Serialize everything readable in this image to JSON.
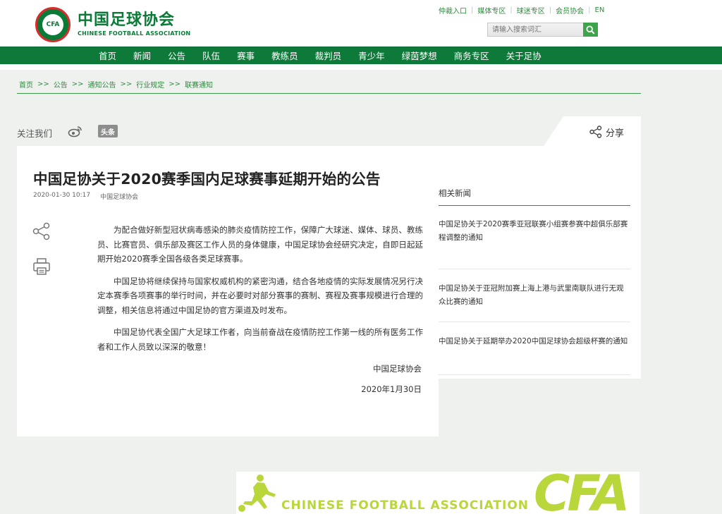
{
  "header": {
    "logo_cn": "中国足球协会",
    "logo_en": "CHINESE FOOTBALL ASSOCIATION",
    "logo_emblem_text": "CFA",
    "top_links": [
      "仲裁入口",
      "媒体专区",
      "球迷专区",
      "会员协会",
      "EN"
    ],
    "search_placeholder": "请输入搜索词汇"
  },
  "nav": {
    "items": [
      "首页",
      "新闻",
      "公告",
      "队伍",
      "赛事",
      "教练员",
      "裁判员",
      "青少年",
      "绿茵梦想",
      "商务专区",
      "关于足协"
    ]
  },
  "breadcrumb": {
    "items": [
      "首页",
      "公告",
      "通知公告",
      "行业规定",
      "联赛通知"
    ],
    "separator": ">>"
  },
  "follow": {
    "label": "关注我们",
    "toutiao": "头条",
    "share_label": "分享"
  },
  "article": {
    "title": "中国足协关于2020赛季国内足球赛事延期开始的公告",
    "date": "2020-01-30 10:17",
    "source": "中国足球协会",
    "paragraphs": [
      "为配合做好新型冠状病毒感染的肺炎疫情防控工作，保障广大球迷、媒体、球员、教练员、比赛官员、俱乐部及赛区工作人员的身体健康，中国足球协会经研究决定，自即日起延期开始2020赛季全国各级各类足球赛事。",
      "中国足协将继续保持与国家权威机构的紧密沟通，结合各地疫情的实际发展情况另行决定本赛季各项赛事的举行时间，并在必要时对部分赛事的赛制、赛程及赛事规模进行合理的调整，相关信息将通过中国足协的官方渠道及时发布。",
      "中国足协代表全国广大足球工作者，向当前奋战在疫情防控工作第一线的所有医务工作者和工作人员致以深深的敬意！"
    ],
    "sign_org": "中国足球协会",
    "sign_date": "2020年1月30日"
  },
  "related": {
    "title": "相关新闻",
    "items": [
      "中国足协关于2020赛季亚冠联赛小组赛参赛中超俱乐部赛程调整的通知",
      "中国足协关于亚冠附加赛上海上港与武里南联队进行无观众比赛的通知",
      "中国足协关于延期举办2020中国足球协会超级杯赛的通知"
    ]
  },
  "footer": {
    "banner_text": "CHINESE FOOTBALL ASSOCIATION",
    "banner_logo": "CFA"
  },
  "colors": {
    "brand_green": "#0e7a3a",
    "link_green": "#2e8b3e",
    "banner_lime": "#b9d63a"
  },
  "icons": [
    "search-icon",
    "weibo-icon",
    "share-icon",
    "print-icon",
    "football-player-icon"
  ]
}
